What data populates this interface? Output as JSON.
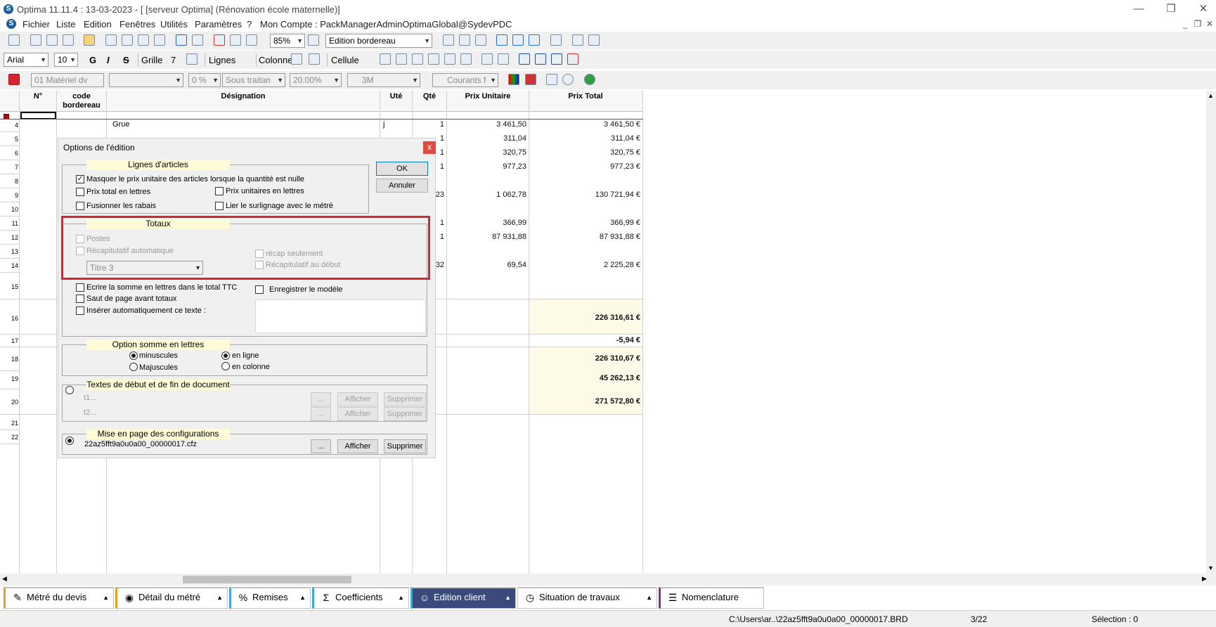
{
  "window": {
    "title": "Optima 11.11.4 : 13-03-2023 - [ [serveur Optima] (Rénovation école maternelle)]",
    "min": "—",
    "restore": "❐",
    "close": "✕",
    "inner_min": "_",
    "inner_restore": "❐",
    "inner_close": "✕"
  },
  "menu": {
    "items": [
      "Fichier",
      "Liste",
      "Edition",
      "Fenêtres",
      "Utilités",
      "Paramètres",
      "?",
      "Mon Compte : PackManagerAdminOptimaGlobal@SydevPDC"
    ]
  },
  "toolbar1": {
    "zoom": "85%",
    "mode": "Edition bordereau"
  },
  "toolbar2": {
    "font": "Arial",
    "size": "10",
    "bold": "G",
    "italic": "I",
    "strike": "S",
    "grille_label": "Grille",
    "grille_value": "7",
    "lignes_label": "Lignes",
    "colonne_label": "Colonne",
    "cellule_label": "Cellule"
  },
  "toolbar3": {
    "materiel": "01  Matériel dv",
    "empty": "",
    "tva": "0 %",
    "sous_traitant": "Sous traitan",
    "pct": "20.00%",
    "unit": "3M",
    "courants": "Courants f"
  },
  "grid": {
    "headers": {
      "num": "N°",
      "code": "code bordereau",
      "designation": "Désignation",
      "ute": "Uté",
      "qte": "Qté",
      "pu": "Prix Unitaire",
      "pt": "Prix Total"
    },
    "rows": [
      {
        "n": "4",
        "designation": "Grue",
        "ute": "j",
        "qte": "1",
        "pu": "3 461,50",
        "pt": "3 461,50 €"
      },
      {
        "n": "5",
        "designation": "",
        "ute": "",
        "qte": "1",
        "pu": "311,04",
        "pt": "311,04 €"
      },
      {
        "n": "6",
        "designation": "",
        "ute": "",
        "qte": "1",
        "pu": "320,75",
        "pt": "320,75 €"
      },
      {
        "n": "7",
        "designation": "",
        "ute": "",
        "qte": "1",
        "pu": "977,23",
        "pt": "977,23 €"
      },
      {
        "n": "8",
        "designation": "",
        "ute": "",
        "qte": "",
        "pu": "",
        "pt": ""
      },
      {
        "n": "9",
        "designation": "",
        "ute": "",
        "qte": "23",
        "pu": "1 062,78",
        "pt": "130 721,94 €"
      },
      {
        "n": "10",
        "designation": "",
        "ute": "",
        "qte": "",
        "pu": "",
        "pt": ""
      },
      {
        "n": "11",
        "designation": "",
        "ute": "",
        "qte": "1",
        "pu": "366,99",
        "pt": "366,99 €"
      },
      {
        "n": "12",
        "designation": "",
        "ute": "",
        "qte": "1",
        "pu": "87 931,88",
        "pt": "87 931,88 €"
      },
      {
        "n": "13",
        "designation": "",
        "ute": "",
        "qte": "",
        "pu": "",
        "pt": ""
      },
      {
        "n": "14",
        "designation": "",
        "ute": "",
        "qte": "32",
        "pu": "69,54",
        "pt": "2 225,28 €"
      },
      {
        "n": "15",
        "designation": "",
        "ute": "",
        "qte": "",
        "pu": "",
        "pt": ""
      },
      {
        "n": "16",
        "designation": "",
        "ute": "",
        "qte": "",
        "pu": "",
        "pt": "226 316,61 €"
      },
      {
        "n": "17",
        "designation": "",
        "ute": "",
        "qte": "",
        "pu": "",
        "pt": "-5,94 €"
      },
      {
        "n": "18",
        "designation": "",
        "ute": "",
        "qte": "",
        "pu": "",
        "pt": "226 310,67 €"
      },
      {
        "n": "19",
        "designation": "",
        "ute": "",
        "qte": "",
        "pu": "",
        "pt": "45 262,13 €"
      },
      {
        "n": "20",
        "designation": "",
        "ute": "",
        "qte": "",
        "pu": "",
        "pt": "271 572,80 €"
      },
      {
        "n": "21",
        "designation": "",
        "ute": "",
        "qte": "",
        "pu": "",
        "pt": ""
      },
      {
        "n": "22",
        "designation": "",
        "ute": "",
        "qte": "",
        "pu": "",
        "pt": ""
      }
    ]
  },
  "dialog": {
    "title": "Options de l'édition",
    "close": "x",
    "ok": "OK",
    "cancel": "Annuler",
    "lignes": {
      "title": "Lignes d'articles",
      "masquer": "Masquer le prix unitaire des articles lorsque la quantité est nulle",
      "prix_total_lettres": "Prix total en lettres",
      "prix_unit_lettres": "Prix unitaires en lettres",
      "fusionner": "Fusionner les rabais",
      "lier": "Lier le surlignage avec le métré"
    },
    "totaux": {
      "title": "Totaux",
      "postes": "Postes",
      "recap_auto": "Récapitulatif automatique",
      "recap_seul": "récap seulement",
      "recap_debut": "Récapitulatif au début",
      "titre": "Titre 3"
    },
    "other": {
      "ecrire": "Ecrire la somme en lettres dans le total TTC",
      "saut": "Saut de page avant totaux",
      "inserer": "Insérer automatiquement ce texte :",
      "enregistrer": "Enregistrer le modèle"
    },
    "somme": {
      "title": "Option somme en lettres",
      "minuscules": "minuscules",
      "majuscules": "Majuscules",
      "en_ligne": "en ligne",
      "en_colonne": "en colonne"
    },
    "textes": {
      "title": "Textes de début et de fin de document",
      "t1": "t1...",
      "t2": "t2...",
      "dots": "...",
      "afficher": "Afficher",
      "supprimer": "Supprimer"
    },
    "mise": {
      "title": "Mise en page des configurations",
      "file": "22az5fft9a0u0a00_00000017.cfz",
      "dots": "...",
      "afficher": "Afficher",
      "supprimer": "Supprimer"
    }
  },
  "tabs": [
    {
      "label": "Métré du devis",
      "icon": "✎",
      "active": false
    },
    {
      "label": "Détail du métré",
      "icon": "◉",
      "active": false
    },
    {
      "label": "Remises",
      "icon": "%",
      "active": false
    },
    {
      "label": "Coefficients",
      "icon": "Σ",
      "active": false
    },
    {
      "label": "Edition client",
      "icon": "☺",
      "active": true
    },
    {
      "label": "Situation de travaux",
      "icon": "◷",
      "active": false
    },
    {
      "label": "Nomenclature",
      "icon": "☰",
      "active": false
    }
  ],
  "status": {
    "path": "C:\\Users\\ar..\\22az5fft9a0u0a00_00000017.BRD",
    "page": "3/22",
    "selection": "Sélection : 0"
  },
  "colors": {
    "accent": "#3b4a7c",
    "highlight": "#d9232e",
    "group_title": "#fffbd6"
  }
}
